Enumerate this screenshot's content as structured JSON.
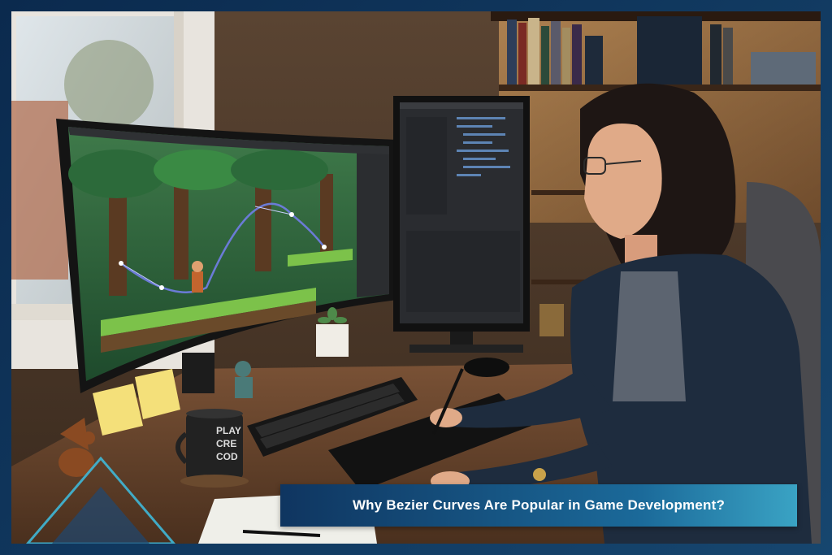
{
  "banner": {
    "title": "Why Bezier Curves Are Popular in Game Development?"
  },
  "mug": {
    "text_lines": [
      "PLAY",
      "CRE",
      "COD"
    ]
  },
  "colors": {
    "frame_dark": "#0b2a4e",
    "banner_start": "#0f3560",
    "banner_end": "#3aa3c4",
    "accent_cyan": "#3fb8d8",
    "curve_color": "#6b7bd6"
  },
  "icons": {
    "decor": "triangle-accent"
  }
}
